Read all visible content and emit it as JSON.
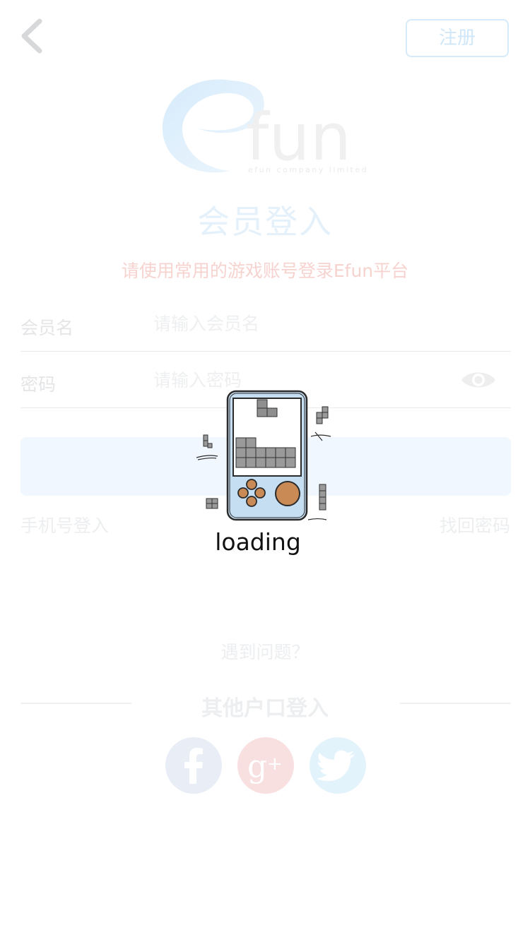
{
  "header": {
    "back_icon": "chevron-left-icon",
    "register_label": "注册"
  },
  "logo": {
    "brand": "fun",
    "tagline": "efun company limited"
  },
  "login": {
    "title": "会员登入",
    "subtitle": "请使用常用的游戏账号登录Efun平台",
    "username_label": "会员名",
    "username_placeholder": "请输入会员名",
    "password_label": "密码",
    "password_placeholder": "请输入密码",
    "password_visibility_icon": "eye-icon",
    "phone_login_label": "手机号登入",
    "forgot_password_label": "找回密码",
    "help_label": "遇到问题？"
  },
  "other_login": {
    "title": "其他户口登入",
    "providers": [
      {
        "name": "facebook-icon"
      },
      {
        "name": "google-plus-icon"
      },
      {
        "name": "twitter-icon"
      }
    ]
  },
  "loading": {
    "icon": "handheld-game-console-icon",
    "text": "loading"
  },
  "colors": {
    "accent_blue": "#cfe7f8",
    "subtitle_red": "#f7d3d0",
    "login_button_bg": "#f0f7fe",
    "facebook_bg": "#e8edf6",
    "google_bg": "#f8dfe0",
    "twitter_bg": "#e3f3fc",
    "console_body": "#c6def2",
    "console_button": "#c98a55"
  }
}
